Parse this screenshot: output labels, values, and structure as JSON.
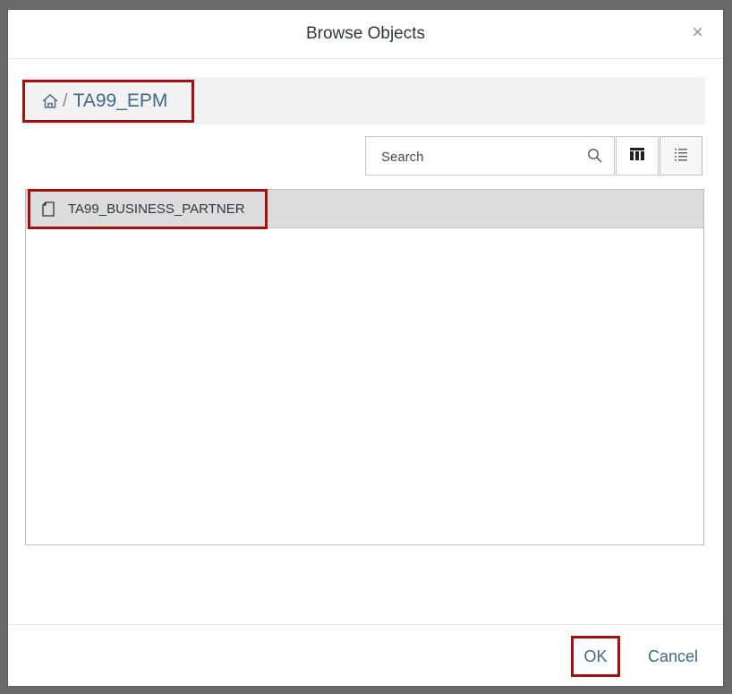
{
  "dialog": {
    "title": "Browse Objects",
    "close_icon": "close-icon"
  },
  "breadcrumb": {
    "home_icon": "home-icon",
    "separator": "/",
    "current": "TA99_EPM"
  },
  "toolbar": {
    "search_placeholder": "Search",
    "search_icon": "search-icon",
    "grid_view_icon": "grid-view-icon",
    "list_view_icon": "list-view-icon"
  },
  "objects": {
    "items": [
      {
        "label": "TA99_BUSINESS_PARTNER",
        "icon": "file-icon"
      }
    ]
  },
  "footer": {
    "ok_label": "OK",
    "cancel_label": "Cancel"
  },
  "colors": {
    "accent": "#3e6a8a",
    "highlight_border": "#a50f0f",
    "selected_row": "#dcdcdc"
  }
}
